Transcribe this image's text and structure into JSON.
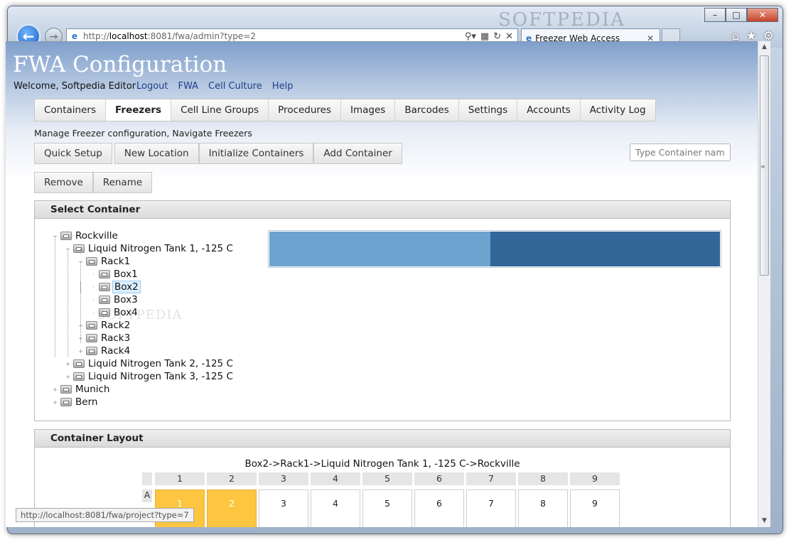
{
  "browser": {
    "url_prefix": "http://",
    "url_host": "localhost",
    "url_rest": ":8081/fwa/admin?type=2",
    "tab_title": "Freezer Web Access",
    "watermark": "SOFTPEDIA",
    "status_url": "http://localhost:8081/fwa/project?type=7"
  },
  "header": {
    "title": "FWA Configuration",
    "welcome": "Welcome, Softpedia Editor",
    "links": [
      "Logout",
      "FWA",
      "Cell Culture",
      "Help"
    ]
  },
  "nav": {
    "tabs": [
      "Containers",
      "Freezers",
      "Cell Line Groups",
      "Procedures",
      "Images",
      "Barcodes",
      "Settings",
      "Accounts",
      "Activity Log"
    ],
    "active": "Freezers"
  },
  "subtitle": "Manage Freezer configuration, Navigate Freezers",
  "toolbar": {
    "row1": [
      "Quick Setup",
      "New Location",
      "Initialize Containers",
      "Add Container"
    ],
    "row2": [
      "Remove",
      "Rename"
    ],
    "search_placeholder": "Type Container name"
  },
  "select_panel": {
    "title": "Select Container",
    "tree": [
      {
        "label": "Rockville",
        "level": 0,
        "expanded": true
      },
      {
        "label": "Liquid Nitrogen Tank 1, -125 C",
        "level": 1,
        "expanded": true
      },
      {
        "label": "Rack1",
        "level": 2,
        "expanded": true
      },
      {
        "label": "Box1",
        "level": 3
      },
      {
        "label": "Box2",
        "level": 3,
        "selected": true
      },
      {
        "label": "Box3",
        "level": 3
      },
      {
        "label": "Box4",
        "level": 3
      },
      {
        "label": "Rack2",
        "level": 2
      },
      {
        "label": "Rack3",
        "level": 2
      },
      {
        "label": "Rack4",
        "level": 2
      },
      {
        "label": "Liquid Nitrogen Tank 2, -125 C",
        "level": 1
      },
      {
        "label": "Liquid Nitrogen Tank 3, -125 C",
        "level": 1
      },
      {
        "label": "Munich",
        "level": 0
      },
      {
        "label": "Bern",
        "level": 0
      }
    ],
    "usage_fraction": 0.49,
    "colors": {
      "used": "#6aa4cf",
      "free": "#336699"
    }
  },
  "layout_panel": {
    "title": "Container Layout",
    "path": "Box2->Rack1->Liquid Nitrogen Tank 1, -125 C->Rockville",
    "columns": [
      "1",
      "2",
      "3",
      "4",
      "5",
      "6",
      "7",
      "8",
      "9"
    ],
    "row_label": "A",
    "cells": [
      {
        "label": "1",
        "used": true
      },
      {
        "label": "2",
        "used": true
      },
      {
        "label": "3",
        "used": false
      },
      {
        "label": "4",
        "used": false
      },
      {
        "label": "5",
        "used": false
      },
      {
        "label": "6",
        "used": false
      },
      {
        "label": "7",
        "used": false
      },
      {
        "label": "8",
        "used": false
      },
      {
        "label": "9",
        "used": false
      }
    ],
    "used_color": "#fdc540"
  }
}
